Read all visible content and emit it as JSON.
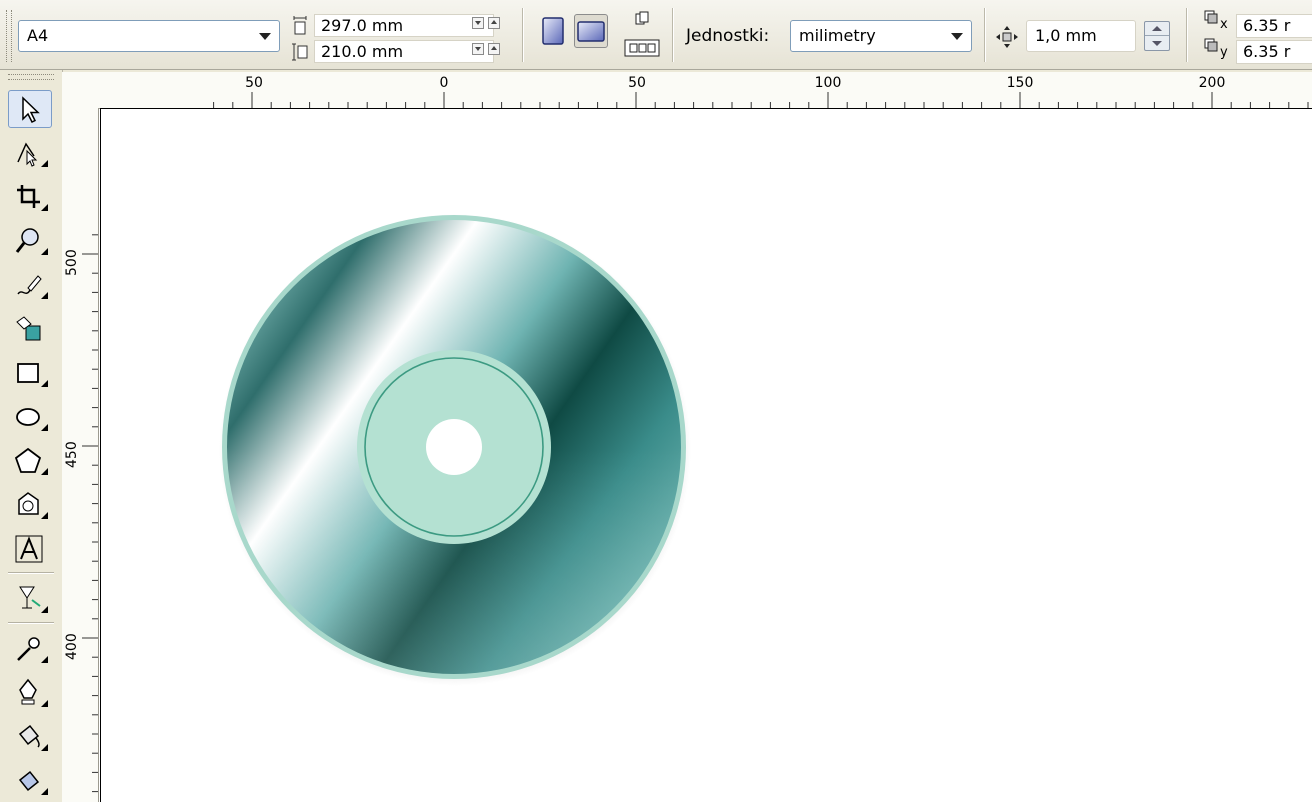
{
  "property_bar": {
    "paper_size": "A4",
    "page_width": "297.0 mm",
    "page_height": "210.0 mm",
    "units_label": "Jednostki:",
    "units_value": "milimetry",
    "nudge_distance": "1,0 mm",
    "duplicate_x": "6.35 r",
    "duplicate_y": "6.35 r"
  },
  "rulers": {
    "horizontal_labels": [
      "50",
      "0",
      "50",
      "100",
      "150",
      "200"
    ],
    "vertical_labels": [
      "500",
      "450",
      "400"
    ]
  },
  "toolbox": {
    "tools": [
      "pick-tool",
      "shape-tool",
      "crop-tool",
      "zoom-tool",
      "freehand-tool",
      "smart-fill-tool",
      "rectangle-tool",
      "ellipse-tool",
      "polygon-tool",
      "basic-shapes-tool",
      "text-tool",
      "interactive-blend-tool",
      "eyedropper-tool",
      "outline-pen-tool",
      "fill-tool",
      "interactive-fill-tool"
    ]
  },
  "colors": {
    "disc_dark": "#0f4a44",
    "disc_light": "#ffffff",
    "disc_rim": "#a8d8cb",
    "hub": "#b4e1d2",
    "hub_ring": "#3c9a82"
  }
}
